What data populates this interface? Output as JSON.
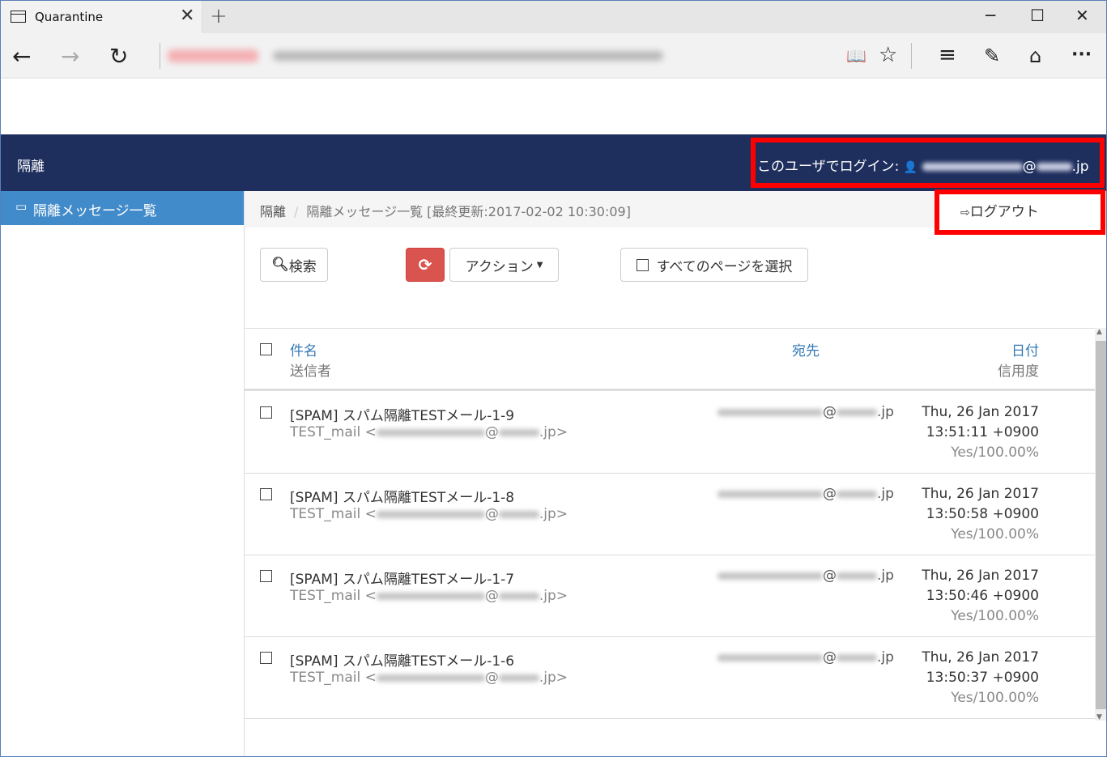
{
  "browser": {
    "tab_title": "Quarantine",
    "tab_close": "✕",
    "new_tab": "+",
    "win_min": "─",
    "win_max": "☐",
    "win_close": "✕",
    "back": "←",
    "forward": "→",
    "refresh": "↻",
    "reading_view": "📖",
    "favorite": "☆",
    "hub": "≡",
    "web_note": "✎",
    "share": "⌂",
    "more": "···"
  },
  "app": {
    "title": "隔離",
    "login_prefix": "このユーザでログイン: ",
    "login_user_icon": "👤",
    "login_at": "@",
    "login_suffix": ".jp",
    "sidebar_item": "隔離メッセージ一覧",
    "sidebar_icon": "inbox-icon",
    "logout_label": "ログアウト",
    "logout_icon": "sign-out-icon"
  },
  "breadcrumb": {
    "root": "隔離",
    "separator": "/",
    "current": "隔離メッセージ一覧 [最終更新:2017-02-02 10:30:09]"
  },
  "toolbar": {
    "search_label": "検索",
    "search_icon": "search-icon",
    "refresh_icon": "refresh-icon",
    "action_label": "アクション",
    "select_all_label": "すべてのページを選択"
  },
  "table": {
    "col_subject": "件名",
    "col_sender": "送信者",
    "col_to": "宛先",
    "col_date": "日付",
    "col_confidence": "信用度",
    "rows": [
      {
        "subject": "[SPAM] スパム隔離TESTメール-1-9",
        "from_prefix": "TEST_mail <",
        "from_at": "@",
        "from_suffix": ".jp>",
        "to_at": "@",
        "to_suffix": ".jp",
        "date": "Thu, 26 Jan 2017",
        "time": "13:51:11 +0900",
        "confidence": "Yes/100.00%"
      },
      {
        "subject": "[SPAM] スパム隔離TESTメール-1-8",
        "from_prefix": "TEST_mail <",
        "from_at": "@",
        "from_suffix": ".jp>",
        "to_at": "@",
        "to_suffix": ".jp",
        "date": "Thu, 26 Jan 2017",
        "time": "13:50:58 +0900",
        "confidence": "Yes/100.00%"
      },
      {
        "subject": "[SPAM] スパム隔離TESTメール-1-7",
        "from_prefix": "TEST_mail <",
        "from_at": "@",
        "from_suffix": ".jp>",
        "to_at": "@",
        "to_suffix": ".jp",
        "date": "Thu, 26 Jan 2017",
        "time": "13:50:46 +0900",
        "confidence": "Yes/100.00%"
      },
      {
        "subject": "[SPAM] スパム隔離TESTメール-1-6",
        "from_prefix": "TEST_mail <",
        "from_at": "@",
        "from_suffix": ".jp>",
        "to_at": "@",
        "to_suffix": ".jp",
        "date": "Thu, 26 Jan 2017",
        "time": "13:50:37 +0900",
        "confidence": "Yes/100.00%"
      }
    ]
  },
  "colors": {
    "header_bg": "#1e2e5d",
    "sidebar_active": "#428bca",
    "refresh_btn": "#d9534f",
    "highlight": "#ff0000",
    "link": "#337ab7"
  }
}
